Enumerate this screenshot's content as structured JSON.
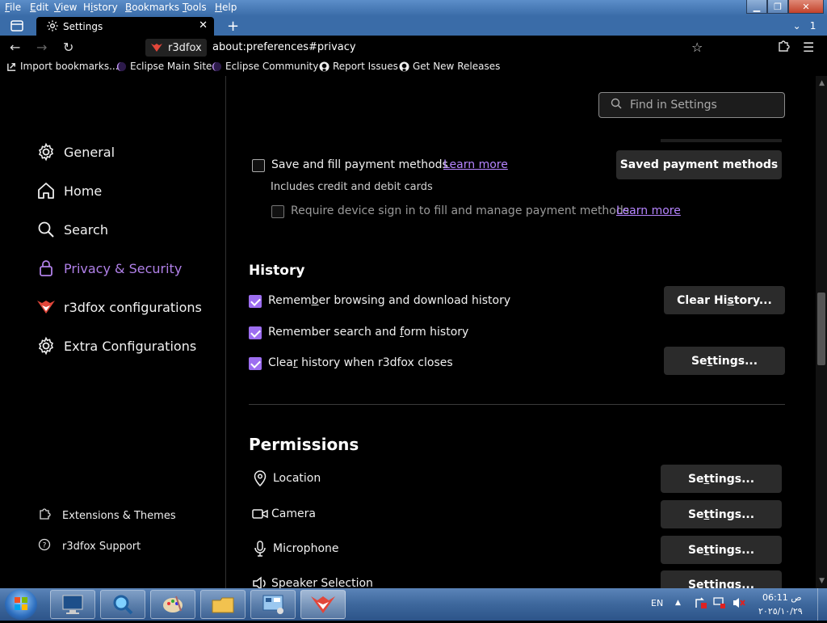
{
  "menubar": {
    "items": [
      "File",
      "Edit",
      "View",
      "History",
      "Bookmarks",
      "Tools",
      "Help"
    ],
    "access_keys": [
      "F",
      "E",
      "V",
      "i",
      "B",
      "T",
      "H"
    ]
  },
  "tabs": {
    "active_title": "Settings",
    "count": "1"
  },
  "navbar": {
    "identity_label": "r3dfox",
    "url": "about:preferences#privacy"
  },
  "bookmarks": [
    {
      "label": "Import bookmarks...",
      "icon": "import-icon"
    },
    {
      "label": "Eclipse Main Site",
      "icon": "eclipse-icon"
    },
    {
      "label": "Eclipse Community",
      "icon": "eclipse-icon"
    },
    {
      "label": "Report Issues",
      "icon": "github-icon"
    },
    {
      "label": "Get New Releases",
      "icon": "github-icon"
    }
  ],
  "search": {
    "placeholder": "Find in Settings"
  },
  "sidebar": {
    "categories": [
      {
        "label": "General",
        "icon": "gear-icon"
      },
      {
        "label": "Home",
        "icon": "home-icon"
      },
      {
        "label": "Search",
        "icon": "search-icon"
      },
      {
        "label": "Privacy & Security",
        "icon": "lock-icon"
      },
      {
        "label": "r3dfox configurations",
        "icon": "r3dfox-logo-icon"
      },
      {
        "label": "Extra Configurations",
        "icon": "gear-icon"
      }
    ],
    "selected_index": 3,
    "footer_links": [
      {
        "label": "Extensions & Themes",
        "icon": "puzzle-icon"
      },
      {
        "label": "r3dfox Support",
        "icon": "help-icon"
      }
    ]
  },
  "payments": {
    "save_fill_label": "Save and fill payment methods",
    "learn_more": "Learn more",
    "description": "Includes credit and debit cards",
    "require_signin_label": "Require device sign in to fill and manage payment methods",
    "saved_button": "Saved payment methods"
  },
  "history": {
    "heading": "History",
    "remember_browsing": "Remember browsing and download history",
    "remember_search": "Remember search and form history",
    "clear_on_close": "Clear history when r3dfox closes",
    "clear_button": "Clear History...",
    "settings_button": "Settings..."
  },
  "permissions": {
    "heading": "Permissions",
    "items": [
      {
        "label": "Location",
        "icon": "location-pin-icon",
        "button": "Settings..."
      },
      {
        "label": "Camera",
        "icon": "camera-icon",
        "button": "Settings..."
      },
      {
        "label": "Microphone",
        "icon": "microphone-icon",
        "button": "Settings..."
      },
      {
        "label": "Speaker Selection",
        "icon": "speaker-icon",
        "button": "Settings..."
      }
    ]
  },
  "taskbar": {
    "language": "EN",
    "time": "06:11 ص",
    "date": "٢٠٢٥/١٠/٢٩"
  },
  "colors": {
    "accent": "#9d6ef0",
    "link": "#b685ff",
    "taskbar": "#3d679c"
  }
}
